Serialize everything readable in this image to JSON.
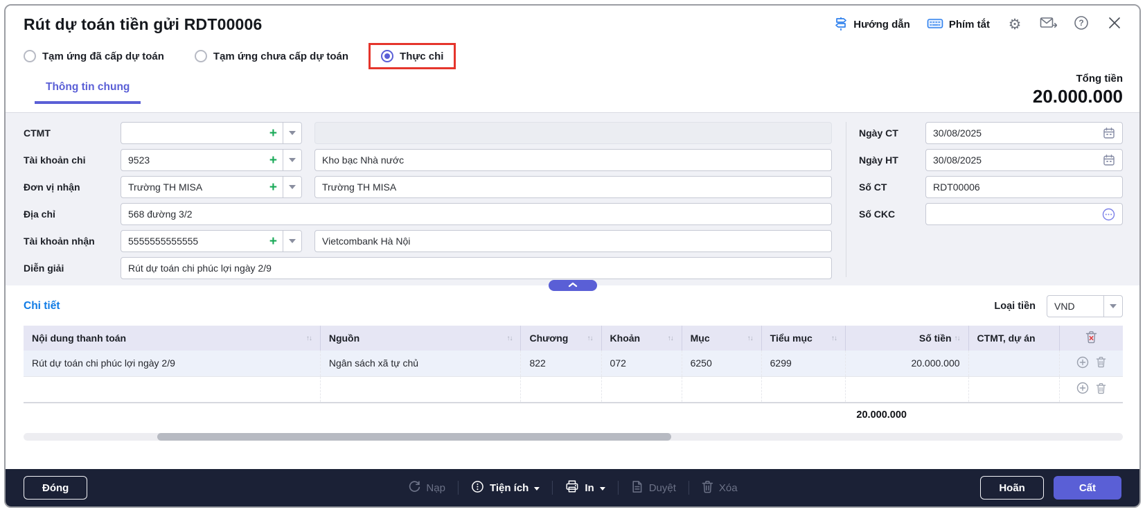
{
  "window": {
    "title": "Rút dự toán tiền gửi RDT00006"
  },
  "header": {
    "guide_label": "Hướng dẫn",
    "shortcuts_label": "Phím tắt"
  },
  "voucher_types": [
    {
      "label": "Tạm ứng đã cấp dự toán",
      "selected": false
    },
    {
      "label": "Tạm ứng chưa cấp dự toán",
      "selected": false
    },
    {
      "label": "Thực chi",
      "selected": true,
      "highlighted": true
    }
  ],
  "tab": {
    "label": "Thông tin chung"
  },
  "total": {
    "label": "Tổng tiền",
    "value": "20.000.000"
  },
  "form": {
    "ctmt": {
      "label": "CTMT",
      "code": "",
      "detail": ""
    },
    "account_pay": {
      "label": "Tài khoản chi",
      "code": "9523",
      "detail": "Kho bạc Nhà nước"
    },
    "receiver": {
      "label": "Đơn vị nhận",
      "code": "Trường TH MISA",
      "detail": "Trường TH MISA"
    },
    "address": {
      "label": "Địa chỉ",
      "value": "568 đường 3/2"
    },
    "account_receive": {
      "label": "Tài khoản nhận",
      "code": "5555555555555",
      "detail": "Vietcombank Hà Nội"
    },
    "description": {
      "label": "Diễn giải",
      "value": "Rút dự toán chi phúc lợi ngày 2/9"
    },
    "doc_date": {
      "label": "Ngày CT",
      "value": "30/08/2025"
    },
    "posted_date": {
      "label": "Ngày HT",
      "value": "30/08/2025"
    },
    "doc_no": {
      "label": "Số CT",
      "value": "RDT00006"
    },
    "ckc_no": {
      "label": "Số CKC",
      "value": ""
    }
  },
  "detail": {
    "title": "Chi tiết",
    "currency": {
      "label": "Loại tiền",
      "value": "VND"
    },
    "table": {
      "columns": [
        {
          "label": "Nội dung thanh toán"
        },
        {
          "label": "Nguồn"
        },
        {
          "label": "Chương"
        },
        {
          "label": "Khoản"
        },
        {
          "label": "Mục"
        },
        {
          "label": "Tiểu mục"
        },
        {
          "label": "Số tiền"
        },
        {
          "label": "CTMT, dự án"
        }
      ],
      "rows": [
        {
          "content": "Rút dự toán chi phúc lợi ngày 2/9",
          "source": "Ngân sách xã tự chủ",
          "chapter": "822",
          "clause": "072",
          "item": "6250",
          "sub_item": "6299",
          "amount": "20.000.000",
          "ctmt": ""
        },
        {
          "content": "",
          "source": "",
          "chapter": "",
          "clause": "",
          "item": "",
          "sub_item": "",
          "amount": "",
          "ctmt": ""
        }
      ],
      "total_amount": "20.000.000"
    }
  },
  "footer": {
    "close": "Đóng",
    "reload": "Nạp",
    "utilities": "Tiện ích",
    "print": "In",
    "approve": "Duyệt",
    "delete": "Xóa",
    "postpone": "Hoãn",
    "save": "Cất"
  },
  "colors": {
    "accent": "#5a5fd6",
    "link_blue": "#0f7be5",
    "highlight_red": "#e5352c",
    "footer_bg": "#1b2136",
    "table_header_bg": "#e6e6f4",
    "selected_row_bg": "#edf1fa"
  }
}
